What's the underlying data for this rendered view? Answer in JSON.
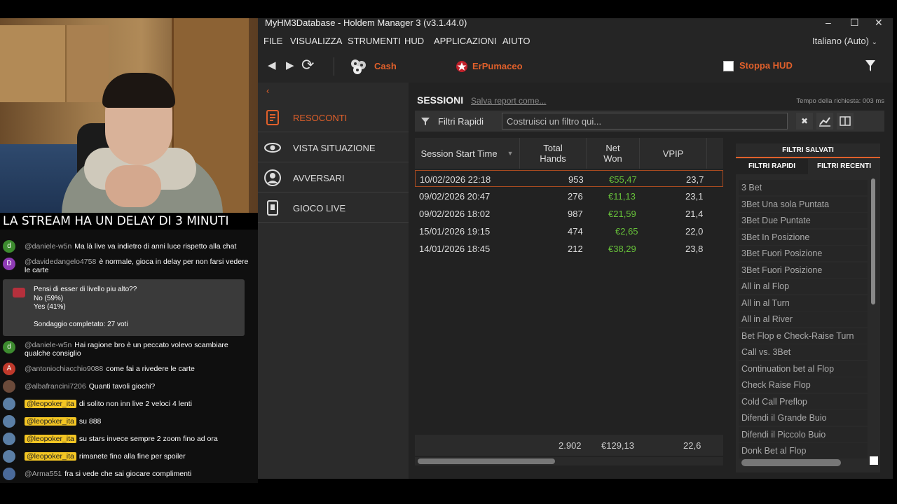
{
  "stream": {
    "banner": "LA STREAM HA UN DELAY DI 3 MINUTI"
  },
  "chat": {
    "messages": [
      {
        "avatar": "d",
        "user": "@daniele-w5n",
        "text": "Ma là live va indietro di anni luce rispetto alla chat"
      },
      {
        "avatar": "D",
        "user": "@davidedangelo4758",
        "text": "è normale, gioca in delay per non farsi vedere le carte"
      },
      {
        "avatar": "d",
        "user": "@daniele-w5n",
        "text": "Hai ragione bro è un peccato volevo scambiare qualche consiglio"
      },
      {
        "avatar": "A",
        "user": "@antoniochiacchio9088",
        "text": "come fai a rivedere le carte"
      },
      {
        "avatar": "",
        "user": "@albafrancini7206",
        "text": "Quanti tavoli giochi?"
      },
      {
        "avatar": "",
        "user": "@leopoker_ita",
        "text": "di solito non inn live 2 veloci 4 lenti"
      },
      {
        "avatar": "",
        "user": "@leopoker_ita",
        "text": "su 888"
      },
      {
        "avatar": "",
        "user": "@leopoker_ita",
        "text": "su stars invece sempre 2 zoom fino ad ora"
      },
      {
        "avatar": "",
        "user": "@leopoker_ita",
        "text": "rimanete fino alla fine per spoiler"
      },
      {
        "avatar": "",
        "user": "@Arma551",
        "text": "fra si vede che sai giocare complimenti"
      }
    ],
    "poll": {
      "question": "Pensi di esser di livello piu alto??",
      "option1": "No (59%)",
      "option2": "Yes (41%)",
      "status": "Sondaggio completato: 27 voti"
    }
  },
  "app": {
    "title": "MyHM3Database - Holdem Manager 3 (v3.1.44.0)",
    "window_buttons": {
      "minimize": "–",
      "maximize": "☐",
      "close": "✕"
    },
    "menu": [
      "FILE",
      "VISUALIZZA",
      "STRUMENTI",
      "HUD",
      "APPLICAZIONI",
      "AIUTO"
    ],
    "language": "Italiano (Auto)",
    "toolbar": {
      "back": "◀",
      "forward": "▶",
      "refresh": "⟳",
      "cash": "Cash",
      "player": "ErPumaceo",
      "stop_hud": "Stoppa HUD"
    },
    "nav": {
      "back_arrow": "‹",
      "items": [
        {
          "label": "RESOCONTI",
          "icon": "report-icon",
          "active": true
        },
        {
          "label": "VISTA SITUAZIONE",
          "icon": "eye-icon",
          "active": false
        },
        {
          "label": "AVVERSARI",
          "icon": "user-icon",
          "active": false
        },
        {
          "label": "GIOCO LIVE",
          "icon": "device-icon",
          "active": false
        }
      ]
    },
    "sessions": {
      "title": "SESSIONI",
      "save_report": "Salva report come...",
      "request_time": "Tempo della richiesta: 003 ms",
      "quick_filters": "Filtri Rapidi",
      "filter_placeholder": "Costruisci un filtro qui...",
      "clear_btn": "✖",
      "columns": [
        "Session Start Time",
        "Total Hands",
        "Net Won",
        "VPIP"
      ],
      "rows": [
        {
          "start": "10/02/2026 22:18",
          "hands": "953",
          "won": "€55,47",
          "vpip": "23,7"
        },
        {
          "start": "09/02/2026 20:47",
          "hands": "276",
          "won": "€11,13",
          "vpip": "23,1"
        },
        {
          "start": "09/02/2026 18:02",
          "hands": "987",
          "won": "€21,59",
          "vpip": "21,4"
        },
        {
          "start": "15/01/2026 19:15",
          "hands": "474",
          "won": "€2,65",
          "vpip": "22,0"
        },
        {
          "start": "14/01/2026 18:45",
          "hands": "212",
          "won": "€38,29",
          "vpip": "23,8"
        }
      ],
      "totals": {
        "hands": "2.902",
        "won": "€129,13",
        "vpip": "22,6"
      }
    },
    "saved_filters": {
      "title": "FILTRI SALVATI",
      "tab_quick": "FILTRI RAPIDI",
      "tab_recent": "FILTRI RECENTI",
      "items": [
        "3 Bet",
        "3Bet Una sola Puntata",
        "3Bet Due Puntate",
        "3Bet In Posizione",
        "3Bet Fuori Posizione",
        "3Bet Fuori Posizione",
        "All in al Flop",
        "All in al Turn",
        "All in al River",
        "Bet Flop e Check-Raise Turn",
        "Call vs. 3Bet",
        "Continuation bet al Flop",
        "Check Raise Flop",
        "Cold Call Preflop",
        "Difendi il Grande Buio",
        "Difendi il Piccolo Buio",
        "Donk Bet al Flop"
      ]
    },
    "colors": {
      "accent": "#e0602b",
      "won": "#67c23a",
      "bg": "#252525"
    }
  }
}
